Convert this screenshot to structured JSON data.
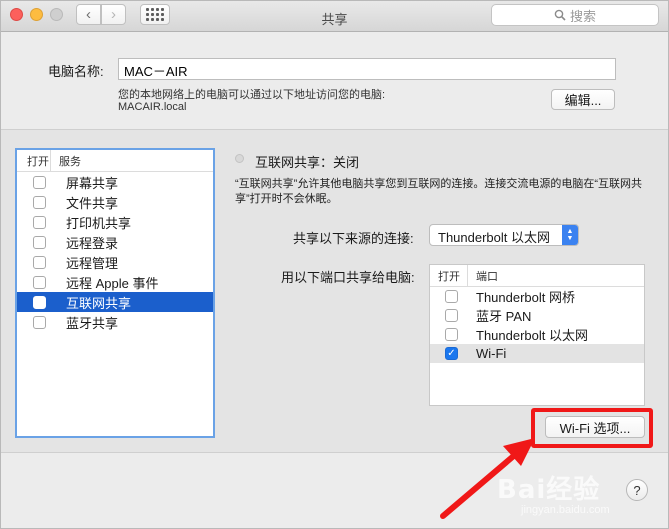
{
  "window": {
    "title": "共享",
    "search_placeholder": "搜索"
  },
  "computer_name": {
    "label": "电脑名称:",
    "value": "MAC－AIR",
    "hint": "您的本地网络上的电脑可以通过以下地址访问您的电脑:",
    "address": "MACAIR.local",
    "edit_button": "编辑..."
  },
  "services": {
    "header_open": "打开",
    "header_service": "服务",
    "items": [
      {
        "label": "屏幕共享",
        "checked": false,
        "selected": false
      },
      {
        "label": "文件共享",
        "checked": false,
        "selected": false
      },
      {
        "label": "打印机共享",
        "checked": false,
        "selected": false
      },
      {
        "label": "远程登录",
        "checked": false,
        "selected": false
      },
      {
        "label": "远程管理",
        "checked": false,
        "selected": false
      },
      {
        "label": "远程 Apple 事件",
        "checked": false,
        "selected": false
      },
      {
        "label": "互联网共享",
        "checked": false,
        "selected": true
      },
      {
        "label": "蓝牙共享",
        "checked": false,
        "selected": false
      }
    ]
  },
  "internet_sharing": {
    "status": "互联网共享：关闭",
    "description": "“互联网共享”允许其他电脑共享您到互联网的连接。连接交流电源的电脑在“互联网共享”打开时不会休眠。",
    "share_from_label": "共享以下来源的连接:",
    "share_from_value": "Thunderbolt 以太网",
    "share_to_label": "用以下端口共享给电脑:",
    "ports_header_open": "打开",
    "ports_header_port": "端口",
    "ports": [
      {
        "label": "Thunderbolt 网桥",
        "checked": false
      },
      {
        "label": "蓝牙 PAN",
        "checked": false
      },
      {
        "label": "Thunderbolt 以太网",
        "checked": false
      },
      {
        "label": "Wi-Fi",
        "checked": true
      }
    ],
    "wifi_options_button": "Wi-Fi 选项..."
  },
  "help_button": "?",
  "watermark": {
    "brand": "Bai经验",
    "url": "jingyan.baidu.com"
  },
  "colors": {
    "selection": "#1b5fcc",
    "annotation_red": "#f01818",
    "list_focus_ring": "#6aa2e6"
  }
}
